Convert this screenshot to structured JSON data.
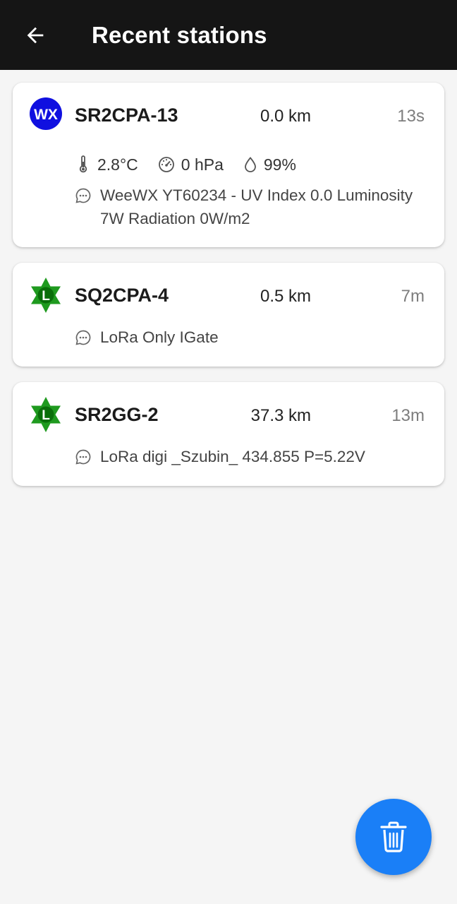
{
  "appbar": {
    "title": "Recent stations",
    "back_icon": "arrow-left-icon"
  },
  "stations": [
    {
      "callsign": "SR2CPA-13",
      "symbol": "WX",
      "symbol_icon": "weather-station-icon",
      "symbol_color": "#1010e0",
      "distance": "0.0 km",
      "age": "13s",
      "weather": {
        "temperature": "2.8°C",
        "pressure": "0 hPa",
        "humidity": "99%"
      },
      "comment": "WeeWX YT60234 - UV Index 0.0 Luminosity 7W Radiation 0W/m2"
    },
    {
      "callsign": "SQ2CPA-4",
      "symbol": "L",
      "symbol_icon": "lora-igate-star-icon",
      "symbol_color": "#1f9a1f",
      "distance": "0.5 km",
      "age": "7m",
      "comment": "LoRa Only IGate"
    },
    {
      "callsign": "SR2GG-2",
      "symbol": "L",
      "symbol_icon": "lora-igate-star-icon",
      "symbol_color": "#1f9a1f",
      "distance": "37.3 km",
      "age": "13m",
      "comment": "LoRa digi _Szubin_ 434.855 P=5.22V"
    }
  ],
  "fab": {
    "icon": "trash-icon",
    "color": "#1a7ff7"
  }
}
